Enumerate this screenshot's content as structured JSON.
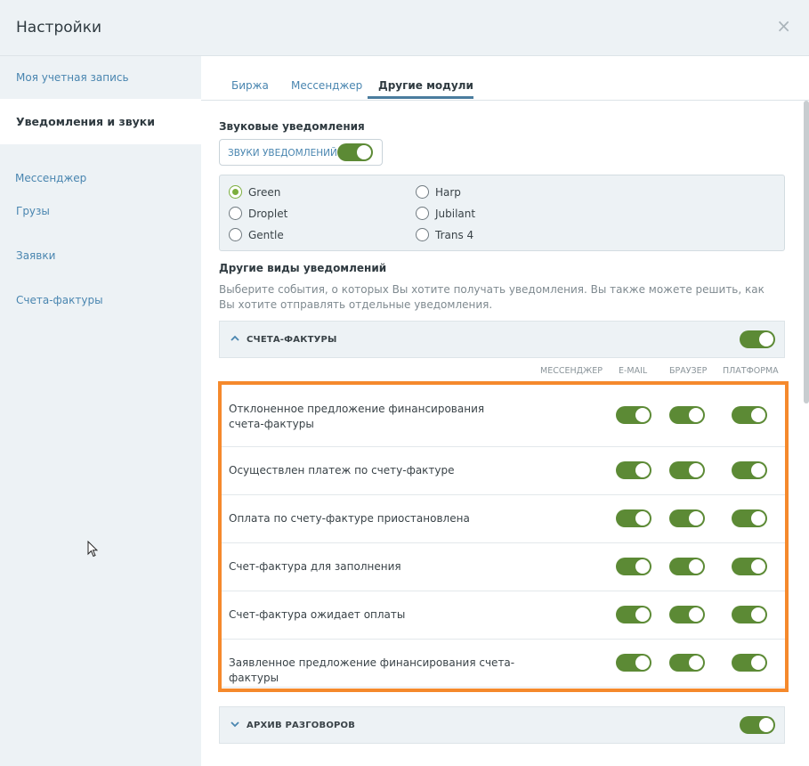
{
  "header": {
    "title": "Настройки",
    "close_icon": "×"
  },
  "sidebar": {
    "items": [
      {
        "label": "Моя учетная запись",
        "active": false
      },
      {
        "label": "Уведомления и звуки",
        "active": true
      },
      {
        "label": "Мессенджер",
        "active": false
      },
      {
        "label": "Грузы",
        "active": false
      },
      {
        "label": "Заявки",
        "active": false
      },
      {
        "label": "Счета-фактуры",
        "active": false
      }
    ]
  },
  "tabs": [
    {
      "label": "Биржа",
      "active": false
    },
    {
      "label": "Мессенджер",
      "active": false
    },
    {
      "label": "Другие модули",
      "active": true
    }
  ],
  "sound": {
    "section_title": "Звуковые уведомления",
    "toggle_label": "ЗВУКИ УВЕДОМЛЕНИЙ",
    "toggle_on": true,
    "options": [
      {
        "label": "Green",
        "checked": true
      },
      {
        "label": "Droplet",
        "checked": false
      },
      {
        "label": "Gentle",
        "checked": false
      },
      {
        "label": "Harp",
        "checked": false
      },
      {
        "label": "Jubilant",
        "checked": false
      },
      {
        "label": "Trans 4",
        "checked": false
      }
    ]
  },
  "other": {
    "section_title": "Другие виды уведомлений",
    "description": "Выберите события, о которых Вы хотите получать уведомления. Вы также можете решить, как Вы хотите отправлять отдельные уведомления."
  },
  "invoices_group": {
    "name": "СЧЕТА-ФАКТУРЫ",
    "expanded": true,
    "toggle_on": true,
    "columns": [
      "МЕССЕНДЖЕР",
      "E-MAIL",
      "БРАУЗЕР",
      "ПЛАТФОРМА"
    ],
    "rows": [
      {
        "label": "Отклоненное предложение финансирования счета-фактуры",
        "email": true,
        "browser": true,
        "platform": true
      },
      {
        "label": "Осуществлен платеж по счету-фактуре",
        "email": true,
        "browser": true,
        "platform": true
      },
      {
        "label": "Оплата по счету-фактуре приостановлена",
        "email": true,
        "browser": true,
        "platform": true
      },
      {
        "label": "Счет-фактура для заполнения",
        "email": true,
        "browser": true,
        "platform": true
      },
      {
        "label": "Счет-фактура ожидает оплаты",
        "email": true,
        "browser": true,
        "platform": true
      },
      {
        "label": "Заявленное предложение финансирования счета-фактуры",
        "email": true,
        "browser": true,
        "platform": true
      }
    ]
  },
  "archive_group": {
    "name": "АРХИВ РАЗГОВОРОВ",
    "expanded": false,
    "toggle_on": true
  },
  "colors": {
    "accent_green": "#5c8a35",
    "highlight_orange": "#f5892c",
    "link_blue": "#4a86b0"
  }
}
